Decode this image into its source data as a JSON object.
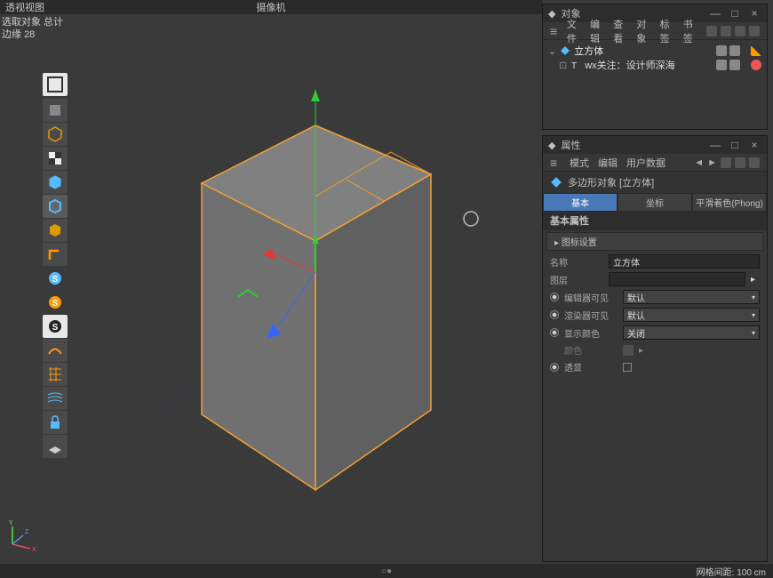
{
  "viewport": {
    "title": "透视视图",
    "camera_label": "摄像机",
    "info_line1": "选取对象 总计",
    "info_edges_label": "边缘",
    "info_edges_value": "28"
  },
  "objects_panel": {
    "title": "对象",
    "menu": [
      "文件",
      "编辑",
      "查看",
      "对象",
      "标签",
      "书签"
    ],
    "tree": [
      {
        "icon": "polygon-icon",
        "name": "立方体"
      },
      {
        "icon": "text-icon",
        "name": "wx关注：设计师深海"
      }
    ]
  },
  "attributes_panel": {
    "title": "属性",
    "menu": [
      "模式",
      "编辑",
      "用户数据"
    ],
    "object_type": "多边形对象 [立方体]",
    "tabs": [
      "基本",
      "坐标",
      "平滑着色(Phong)"
    ],
    "active_tab": 0,
    "section_title": "基本属性",
    "sub_section": "图标设置",
    "fields": {
      "name_label": "名称",
      "name_value": "立方体",
      "layer_label": "图层",
      "layer_value": "",
      "editor_vis_label": "编辑器可见",
      "editor_vis_value": "默认",
      "render_vis_label": "渲染器可见",
      "render_vis_value": "默认",
      "display_color_label": "显示颜色",
      "display_color_value": "关闭",
      "color_label": "颜色",
      "xray_label": "透显"
    }
  },
  "statusbar": {
    "grid_label": "网格间距",
    "grid_value": "100 cm"
  },
  "axis_labels": {
    "x": "X",
    "y": "Y",
    "z": "Z"
  }
}
